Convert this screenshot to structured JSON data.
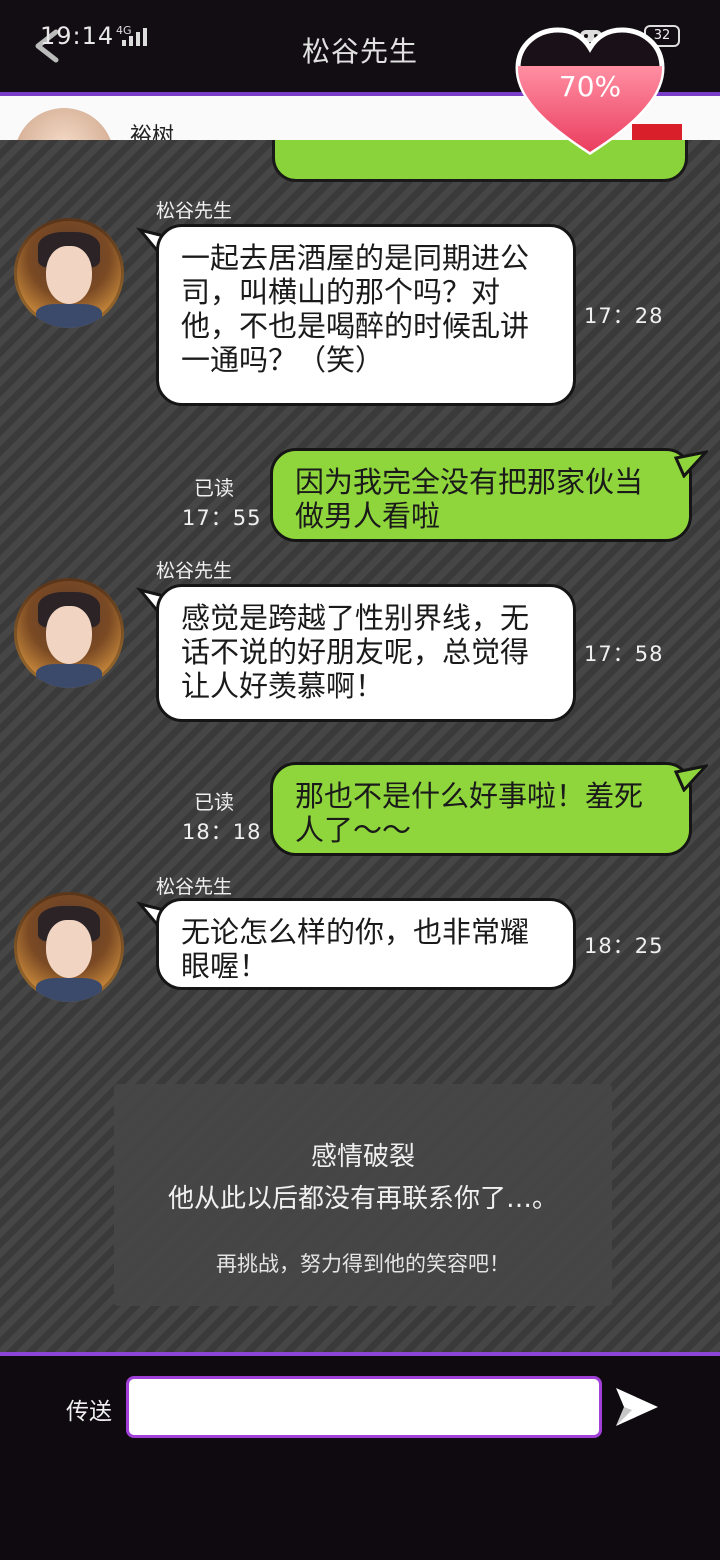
{
  "status": {
    "time": "19:14",
    "network": "4G",
    "battery": "32"
  },
  "header": {
    "title": "松谷先生"
  },
  "peek": {
    "name": "裕树"
  },
  "affection": {
    "value": "70%"
  },
  "messages": [
    {
      "side": "left",
      "sender": "松谷先生",
      "text": "一起去居酒屋的是同期进公司，叫横山的那个吗？对他，不也是喝醉的时候乱讲一通吗？（笑）",
      "time": "17：28"
    },
    {
      "side": "right",
      "read": "已读",
      "text": "因为我完全没有把那家伙当做男人看啦",
      "time": "17：55"
    },
    {
      "side": "left",
      "sender": "松谷先生",
      "text": "感觉是跨越了性别界线，无话不说的好朋友呢，总觉得让人好羡慕啊！",
      "time": "17：58"
    },
    {
      "side": "right",
      "read": "已读",
      "text": "那也不是什么好事啦！羞死人了～～",
      "time": "18：18"
    },
    {
      "side": "left",
      "sender": "松谷先生",
      "text": "无论怎么样的你，也非常耀眼喔！",
      "time": "18：25"
    }
  ],
  "result": {
    "title": "感情破裂",
    "text": "他从此以后都没有再联系你了…。",
    "sub": "再挑战，努力得到他的笑容吧！"
  },
  "composer": {
    "send_label": "传送",
    "value": ""
  },
  "colors": {
    "accent": "#8c44d6",
    "bubble_green": "#8fd63c",
    "heart": "#f0506e"
  }
}
